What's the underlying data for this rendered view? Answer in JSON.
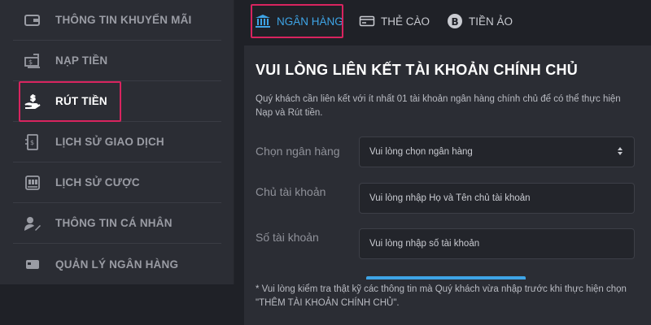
{
  "sidebar": {
    "items": [
      {
        "label": "THÔNG TIN KHUYẾN MÃI",
        "icon": "wallet-icon"
      },
      {
        "label": "NẠP TIỀN",
        "icon": "deposit-icon"
      },
      {
        "label": "RÚT TIỀN",
        "icon": "withdraw-hand-icon"
      },
      {
        "label": "LỊCH SỬ GIAO DỊCH",
        "icon": "transaction-history-icon"
      },
      {
        "label": "LỊCH SỬ CƯỢC",
        "icon": "bet-history-icon"
      },
      {
        "label": "THÔNG TIN CÁ NHÂN",
        "icon": "user-edit-icon"
      },
      {
        "label": "QUẢN LÝ NGÂN HÀNG",
        "icon": "bank-card-icon"
      }
    ],
    "active_index": 2
  },
  "tabs": [
    {
      "label": "NGÂN HÀNG",
      "icon": "bank-icon",
      "active": true
    },
    {
      "label": "THẺ CÀO",
      "icon": "card-icon",
      "active": false
    },
    {
      "label": "TIỀN ẢO",
      "icon": "bitcoin-icon",
      "active": false
    }
  ],
  "panel": {
    "title": "VUI LÒNG LIÊN KẾT TÀI KHOẢN CHÍNH CHỦ",
    "description": "Quý khách cần liên kết với ít nhất 01 tài khoản ngân hàng chính chủ để có thể thực hiện Nạp và Rút tiền.",
    "fields": {
      "bank": {
        "label": "Chọn ngân hàng",
        "value": "Vui lòng chọn ngân hàng"
      },
      "owner": {
        "label": "Chủ tài khoản",
        "placeholder": "Vui lòng nhập Họ và Tên chủ tài khoản"
      },
      "number": {
        "label": "Số tài khoản",
        "placeholder": "Vui lòng nhập số tài khoản"
      }
    },
    "note": "* Vui lòng kiểm tra thật kỹ các thông tin mà Quý khách vừa nhập trước khi thực hiện chọn \"THÊM TÀI KHOẢN CHÍNH CHỦ\"."
  },
  "colors": {
    "accent": "#3ea4e6",
    "highlight": "#d8245f",
    "background": "#1f2127",
    "panel": "#2b2d34"
  }
}
